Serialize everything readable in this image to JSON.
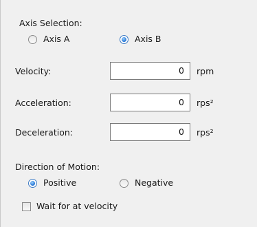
{
  "axis_selection": {
    "title": "Axis Selection:",
    "options": [
      {
        "label": "Axis A",
        "checked": false
      },
      {
        "label": "Axis B",
        "checked": true
      }
    ]
  },
  "fields": [
    {
      "label": "Velocity:",
      "value": "0",
      "unit": "rpm"
    },
    {
      "label": "Acceleration:",
      "value": "0",
      "unit": "rps²"
    },
    {
      "label": "Deceleration:",
      "value": "0",
      "unit": "rps²"
    }
  ],
  "direction": {
    "title": "Direction of Motion:",
    "options": [
      {
        "label": "Positive",
        "checked": true
      },
      {
        "label": "Negative",
        "checked": false
      }
    ]
  },
  "wait_checkbox": {
    "label": "Wait for at velocity",
    "checked": false
  }
}
